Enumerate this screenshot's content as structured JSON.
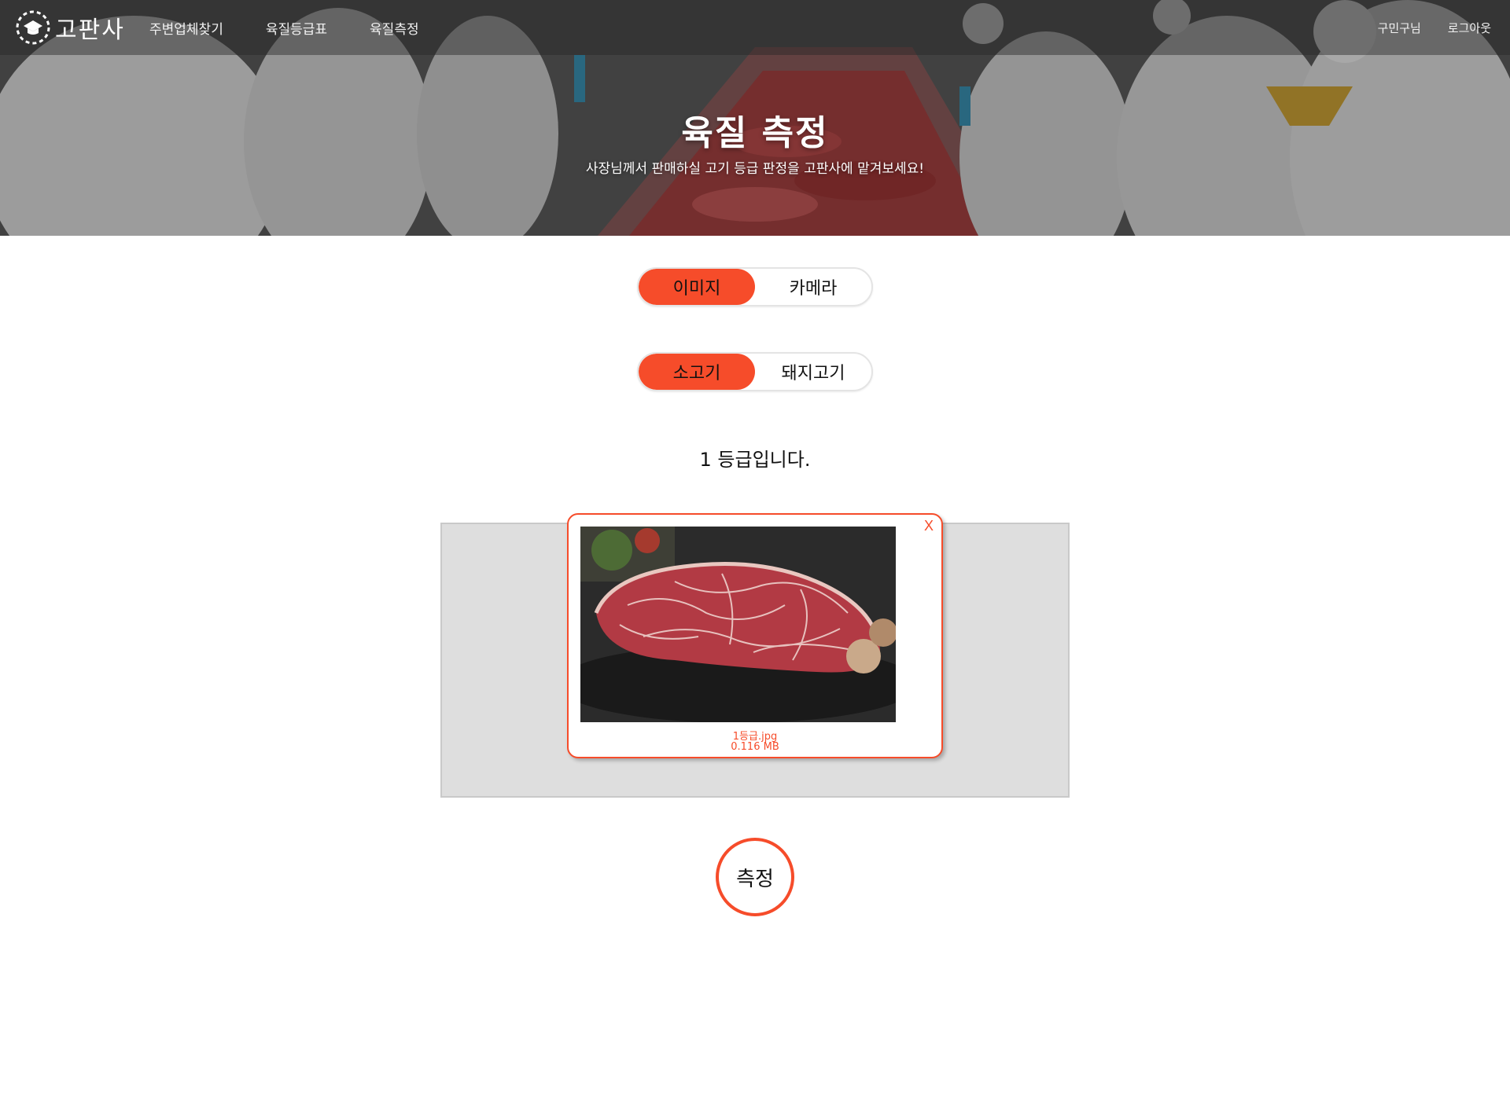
{
  "header": {
    "logo_text": "고판사",
    "nav": [
      "주변업체찾기",
      "육질등급표",
      "육질측정"
    ],
    "user_label": "구민구님",
    "logout_label": "로그아웃"
  },
  "hero": {
    "title": "육질 측정",
    "subtitle": "사장님께서 판매하실 고기 등급 판정을 고판사에 맡겨보세요!"
  },
  "input_toggle": {
    "options": [
      "이미지",
      "카메라"
    ],
    "selected": "이미지"
  },
  "meat_toggle": {
    "options": [
      "소고기",
      "돼지고기"
    ],
    "selected": "소고기"
  },
  "result_text": "1 등급입니다.",
  "upload": {
    "close_label": "X",
    "file_name": "1등급.jpg",
    "file_size": "0.116 MB"
  },
  "measure_button": "측정",
  "colors": {
    "accent": "#f64c2a",
    "dropzone": "#dedede"
  }
}
